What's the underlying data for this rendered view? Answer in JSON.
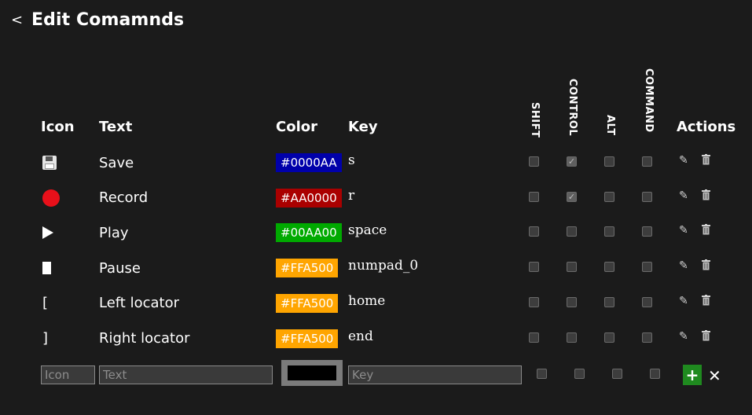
{
  "header": {
    "back_label": "<",
    "title": "Edit Comamnds"
  },
  "columns": {
    "icon": "Icon",
    "text": "Text",
    "color": "Color",
    "key": "Key",
    "shift": "SHIFT",
    "control": "CONTROL",
    "alt": "ALT",
    "command": "COMMAND",
    "actions": "Actions"
  },
  "rows": [
    {
      "icon": "floppy-disk-icon",
      "text": "Save",
      "color": "#0000AA",
      "key": "s",
      "shift": false,
      "control": true,
      "alt": false,
      "command": false
    },
    {
      "icon": "red-circle-icon",
      "text": "Record",
      "color": "#AA0000",
      "key": "r",
      "shift": false,
      "control": true,
      "alt": false,
      "command": false
    },
    {
      "icon": "play-icon",
      "text": "Play",
      "color": "#00AA00",
      "key": "space",
      "shift": false,
      "control": false,
      "alt": false,
      "command": false
    },
    {
      "icon": "pause-icon",
      "text": "Pause",
      "color": "#FFA500",
      "key": "numpad_0",
      "shift": false,
      "control": false,
      "alt": false,
      "command": false
    },
    {
      "icon": "[",
      "text": "Left locator",
      "color": "#FFA500",
      "key": "home",
      "shift": false,
      "control": false,
      "alt": false,
      "command": false
    },
    {
      "icon": "]",
      "text": "Right locator",
      "color": "#FFA500",
      "key": "end",
      "shift": false,
      "control": false,
      "alt": false,
      "command": false
    }
  ],
  "new_row": {
    "icon_placeholder": "Icon",
    "text_placeholder": "Text",
    "color_value": "#000000",
    "key_placeholder": "Key",
    "add_label": "+",
    "cancel_label": "✕"
  }
}
